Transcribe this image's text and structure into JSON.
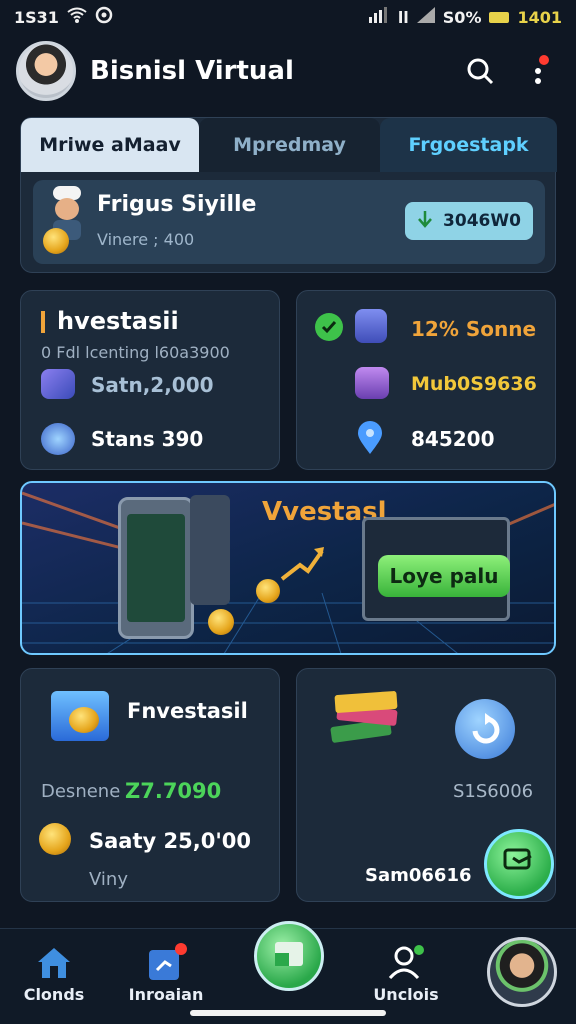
{
  "status": {
    "time": "1S31",
    "battery_pct": "S0%",
    "right_value": "1401",
    "carrier": "ll"
  },
  "header": {
    "title": "Bisnisl Virtual",
    "search_icon": "search-icon",
    "menu_icon": "more-vert-icon",
    "accent": "#ff3b30"
  },
  "tabs": [
    {
      "label": "Mriwe aMaav"
    },
    {
      "label": "Mpredmay"
    },
    {
      "label": "Frgoestapk"
    }
  ],
  "hero": {
    "name": "Frigus Siyille",
    "subtitle": "Vinere ; 400",
    "pill_value": "3046W0"
  },
  "investment": {
    "title": "hvestasii",
    "subtitle": "0 Fdl lcenting l60a3900",
    "row1": "Satn,2,000",
    "row2": "Stans 390"
  },
  "stats": {
    "row1": "12% Sonne",
    "row2": "Mub0S9636",
    "row3": "845200"
  },
  "banner": {
    "title": "Vvestasl",
    "button": "Loye palu"
  },
  "bottom_left": {
    "title": "Fnvestasil",
    "label": "Desnene",
    "value": "Z7.7090",
    "salary": "Saaty 25,0'00",
    "footer": "Viny"
  },
  "bottom_right": {
    "value": "S1S6006",
    "footer": "Sam06616"
  },
  "nav": [
    {
      "label": "Clonds",
      "icon": "home-icon"
    },
    {
      "label": "Inroaian",
      "icon": "chart-icon"
    },
    {
      "label": "",
      "icon": "wallet-icon"
    },
    {
      "label": "Unclois",
      "icon": "user-icon"
    },
    {
      "label": "",
      "icon": "avatar"
    }
  ],
  "colors": {
    "bg": "#0f1723",
    "panel": "#1c2a3a",
    "accent_green": "#38b33a",
    "accent_cyan": "#5fd0ff",
    "orange": "#f0a43a"
  }
}
